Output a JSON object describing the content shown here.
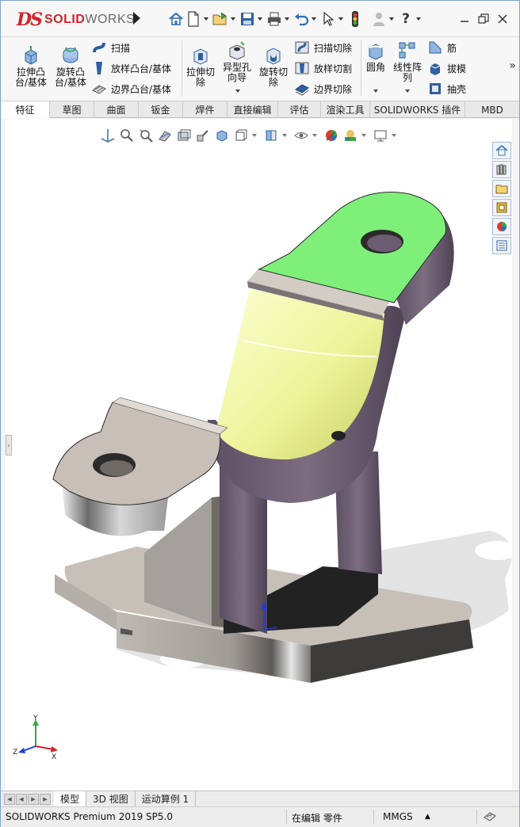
{
  "app": {
    "logo_prefix": "DS",
    "logo_brand": "SOLID",
    "logo_brand_suffix": "WORKS"
  },
  "ribbon": {
    "extrude_boss": "拉伸凸\n台/基体",
    "revolve_boss": "旋转凸\n台/基体",
    "sweep": "扫描",
    "loft_boss": "放样凸台/基体",
    "boundary_boss": "边界凸台/基体",
    "extrude_cut": "拉伸切\n除",
    "hole_wizard": "异型孔\n向导",
    "revolve_cut": "旋转切\n除",
    "sweep_cut": "扫描切除",
    "loft_cut": "放样切割",
    "boundary_cut": "边界切除",
    "fillet": "圆角",
    "linear_pattern": "线性阵\n列",
    "rib": "筋",
    "draft": "拔模",
    "shell": "抽壳"
  },
  "tabs": [
    {
      "label": "特征",
      "active": true
    },
    {
      "label": "草图",
      "active": false
    },
    {
      "label": "曲面",
      "active": false
    },
    {
      "label": "钣金",
      "active": false
    },
    {
      "label": "焊件",
      "active": false
    },
    {
      "label": "直接编辑",
      "active": false
    },
    {
      "label": "评估",
      "active": false
    },
    {
      "label": "渲染工具",
      "active": false
    },
    {
      "label": "SOLIDWORKS 插件",
      "active": false
    },
    {
      "label": "MBD",
      "active": false
    }
  ],
  "triad": {
    "x": "X",
    "y": "Y",
    "z": "Z"
  },
  "bottom_tabs": [
    {
      "label": "模型",
      "active": true
    },
    {
      "label": "3D 视图",
      "active": false
    },
    {
      "label": "运动算例 1",
      "active": false
    }
  ],
  "status": {
    "product": "SOLIDWORKS Premium 2019 SP5.0",
    "mode": "在编辑 零件",
    "units": "MMGS"
  },
  "colors": {
    "brand_red": "#d2232a",
    "face_green": "#7ef07a",
    "face_yellow": "#f1f7a8",
    "body_purple": "#6b5c6f",
    "body_gray": "#8a8782"
  }
}
